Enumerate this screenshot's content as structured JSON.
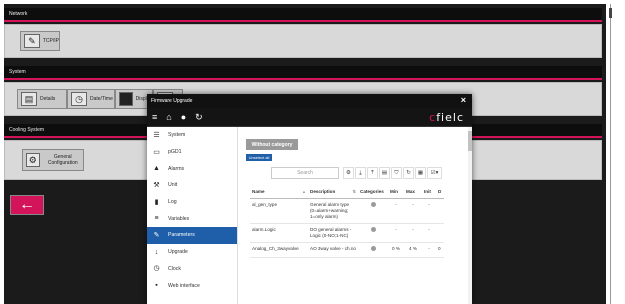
{
  "sections": {
    "network": {
      "title": "Network",
      "tiles": [
        {
          "label": "TCP/IP",
          "icon": "network-cable-icon"
        }
      ]
    },
    "system": {
      "title": "System",
      "tiles": [
        {
          "label": "Details",
          "icon": "details-icon"
        },
        {
          "label": "Date/Time",
          "icon": "clock-icon"
        },
        {
          "label": "Display",
          "icon": "display-icon"
        },
        {
          "label": "",
          "icon": "upgrade-icon"
        }
      ]
    },
    "cooling": {
      "title": "Cooling System",
      "tiles": [
        {
          "label": "General Configuration",
          "icon": "general-config-icon"
        }
      ]
    }
  },
  "back_icon": "←",
  "modal": {
    "title": "Firmware Upgrade",
    "close": "×",
    "brand_c": "c",
    "brand_rest": "fielc",
    "toolbar_icons": [
      "menu-icon",
      "home-icon",
      "user-icon",
      "refresh-icon"
    ],
    "sidebar": [
      {
        "label": "System",
        "icon": "server-icon",
        "glyph": "☰",
        "active": false
      },
      {
        "label": "pGD1",
        "icon": "monitor-icon",
        "glyph": "▭",
        "active": false
      },
      {
        "label": "Alarms",
        "icon": "bell-icon",
        "glyph": "▲",
        "active": false
      },
      {
        "label": "Unit",
        "icon": "wrench-key-icon",
        "glyph": "⚒",
        "active": false
      },
      {
        "label": "Log",
        "icon": "book-icon",
        "glyph": "▮",
        "active": false
      },
      {
        "label": "Variables",
        "icon": "database-icon",
        "glyph": "≡",
        "active": false
      },
      {
        "label": "Parameters",
        "icon": "wrench-icon",
        "glyph": "✎",
        "active": true
      },
      {
        "label": "Upgrade",
        "icon": "arrow-down-icon",
        "glyph": "↓",
        "active": false
      },
      {
        "label": "Clock",
        "icon": "clock-icon",
        "glyph": "◷",
        "active": false
      },
      {
        "label": "Web interface",
        "icon": "web-icon",
        "glyph": "▪",
        "active": false
      }
    ],
    "without_category": "Without category",
    "unselect_all": "Unselect all",
    "search_placeholder": "Search",
    "tool_icons": [
      "settings-icon",
      "download-icon",
      "upload-icon",
      "save-icon",
      "filter-icon",
      "refresh-icon",
      "calendar-icon",
      "columns-icon"
    ],
    "tool_glyphs": [
      "⚙",
      "⤓",
      "⤒",
      "▤",
      "⛉",
      "↻",
      "▦",
      "☑▾"
    ],
    "columns": [
      "Name",
      "Description",
      "Categories",
      "Min",
      "Max",
      "Init",
      "D"
    ],
    "rows": [
      {
        "name": "al_gen_type",
        "description": "General alarm type (0=alarm+warning; 1=only alarm)",
        "min": "-",
        "max": "-",
        "init": "-",
        "d": ""
      },
      {
        "name": "alarm.Logic",
        "description": "DO general alarms - Logic (0-NO;1-NC)",
        "min": "-",
        "max": "-",
        "init": "-",
        "d": ""
      },
      {
        "name": "Analog_Ch_3wayvalve",
        "description": "AO 3way valve - ch.no",
        "min": "0 %",
        "max": "4 %",
        "init": "-",
        "d": "0"
      }
    ]
  }
}
